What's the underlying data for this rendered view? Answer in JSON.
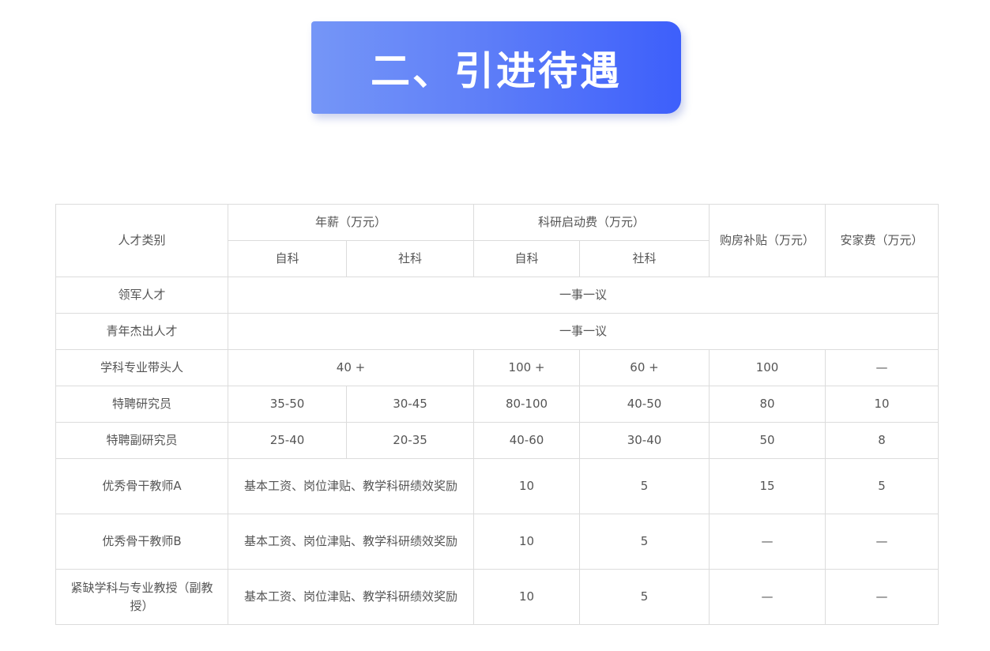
{
  "banner": {
    "title": "二、引进待遇"
  },
  "table": {
    "header": {
      "category": "人才类别",
      "salary": "年薪（万元）",
      "startup_fund": "科研启动费（万元）",
      "housing": "购房补贴（万元）",
      "settling": "安家费（万元）",
      "science": "自科",
      "social": "社科"
    },
    "rows": [
      {
        "category": "领军人才",
        "merged": "一事一议"
      },
      {
        "category": "青年杰出人才",
        "merged": "一事一议"
      },
      {
        "category": "学科专业带头人",
        "salary": "40 +",
        "fund_science": "100 +",
        "fund_social": "60 +",
        "housing": "100",
        "settling": "—"
      },
      {
        "category": "特聘研究员",
        "salary_science": "35-50",
        "salary_social": "30-45",
        "fund_science": "80-100",
        "fund_social": "40-50",
        "housing": "80",
        "settling": "10"
      },
      {
        "category": "特聘副研究员",
        "salary_science": "25-40",
        "salary_social": "20-35",
        "fund_science": "40-60",
        "fund_social": "30-40",
        "housing": "50",
        "settling": "8"
      },
      {
        "category": "优秀骨干教师A",
        "salary": "基本工资、岗位津贴、教学科研绩效奖励",
        "fund_science": "10",
        "fund_social": "5",
        "housing": "15",
        "settling": "5"
      },
      {
        "category": "优秀骨干教师B",
        "salary": "基本工资、岗位津贴、教学科研绩效奖励",
        "fund_science": "10",
        "fund_social": "5",
        "housing": "—",
        "settling": "—"
      },
      {
        "category": "紧缺学科与专业教授（副教授）",
        "salary": "基本工资、岗位津贴、教学科研绩效奖励",
        "fund_science": "10",
        "fund_social": "5",
        "housing": "—",
        "settling": "—"
      }
    ]
  }
}
